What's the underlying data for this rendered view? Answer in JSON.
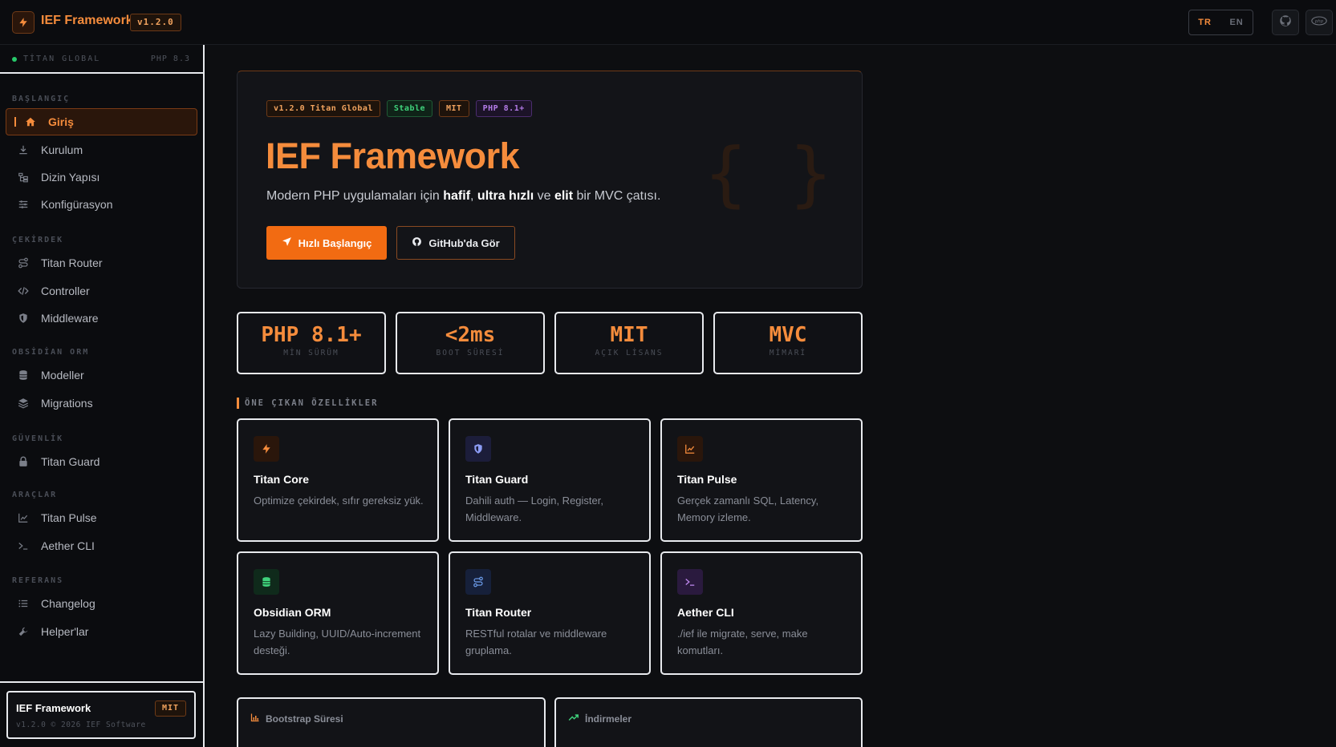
{
  "header": {
    "brand": "IEF Framework",
    "version": "v1.2.0",
    "lang_tr": "TR",
    "lang_en": "EN",
    "icons": [
      "github-icon",
      "php-icon"
    ]
  },
  "sidebar": {
    "status_label": "TİTAN GLOBAL",
    "status_php": "PHP 8.3",
    "sections": [
      {
        "title": "BAŞLANGIÇ",
        "items": [
          {
            "label": "Giriş",
            "icon": "home-icon",
            "active": true
          },
          {
            "label": "Kurulum",
            "icon": "download-icon"
          },
          {
            "label": "Dizin Yapısı",
            "icon": "folder-tree-icon"
          },
          {
            "label": "Konfigürasyon",
            "icon": "sliders-icon"
          }
        ]
      },
      {
        "title": "ÇEKİRDEK",
        "items": [
          {
            "label": "Titan Router",
            "icon": "route-icon"
          },
          {
            "label": "Controller",
            "icon": "code-icon"
          },
          {
            "label": "Middleware",
            "icon": "shield-icon"
          }
        ]
      },
      {
        "title": "OBSİDİAN ORM",
        "items": [
          {
            "label": "Modeller",
            "icon": "database-icon"
          },
          {
            "label": "Migrations",
            "icon": "layers-icon"
          }
        ]
      },
      {
        "title": "GÜVENLİK",
        "items": [
          {
            "label": "Titan Guard",
            "icon": "lock-icon"
          }
        ]
      },
      {
        "title": "ARAÇLAR",
        "items": [
          {
            "label": "Titan Pulse",
            "icon": "chart-line-icon"
          },
          {
            "label": "Aether CLI",
            "icon": "terminal-icon"
          }
        ]
      },
      {
        "title": "REFERANS",
        "items": [
          {
            "label": "Changelog",
            "icon": "list-icon"
          },
          {
            "label": "Helper'lar",
            "icon": "wrench-icon"
          }
        ]
      }
    ],
    "footer": {
      "title": "IEF Framework",
      "subtitle": "v1.2.0 © 2026 IEF Software",
      "badge": "MIT"
    }
  },
  "hero": {
    "tags": [
      "v1.2.0 Titan Global",
      "Stable",
      "MIT",
      "PHP 8.1+"
    ],
    "title": "IEF Framework",
    "desc_1": "Modern PHP uygulamaları için ",
    "desc_b1": "hafif",
    "desc_2": ", ",
    "desc_b2": "ultra hızlı",
    "desc_3": " ve ",
    "desc_b3": "elit",
    "desc_4": " bir MVC çatısı.",
    "primary_button": "Hızlı Başlangıç",
    "secondary_button": "GitHub'da Gör",
    "decor": "{ }"
  },
  "stats": [
    {
      "value": "PHP 8.1+",
      "label": "MİN SÜRÜM"
    },
    {
      "value": "<2ms",
      "label": "BOOT SÜRESİ"
    },
    {
      "value": "MIT",
      "label": "AÇIK LİSANS"
    },
    {
      "value": "MVC",
      "label": "MİMARİ"
    }
  ],
  "features": {
    "heading": "ÖNE ÇIKAN ÖZELLİKLER",
    "cards": [
      {
        "title": "Titan Core",
        "desc": "Optimize çekirdek, sıfır gereksiz yük.",
        "icon": "bolt-icon"
      },
      {
        "title": "Titan Guard",
        "desc": "Dahili auth — Login, Register, Middleware.",
        "icon": "shield-icon"
      },
      {
        "title": "Titan Pulse",
        "desc": "Gerçek zamanlı SQL, Latency, Memory izleme.",
        "icon": "chart-line-icon"
      },
      {
        "title": "Obsidian ORM",
        "desc": "Lazy Building, UUID/Auto-increment desteği.",
        "icon": "database-icon"
      },
      {
        "title": "Titan Router",
        "desc": "RESTful rotalar ve middleware gruplama.",
        "icon": "route-icon"
      },
      {
        "title": "Aether CLI",
        "desc": "./ief ile migrate, serve, make komutları.",
        "icon": "terminal-icon"
      }
    ]
  },
  "bottom": {
    "bootstrap_title": "Bootstrap Süresi",
    "downloads_title": "İndirmeler"
  },
  "colors": {
    "accent": "#f58c3c",
    "primary_button": "#f26b12",
    "background": "#0d0e11",
    "green": "#3fd27b",
    "purple": "#b47ce8",
    "blue": "#7b8cf0"
  }
}
